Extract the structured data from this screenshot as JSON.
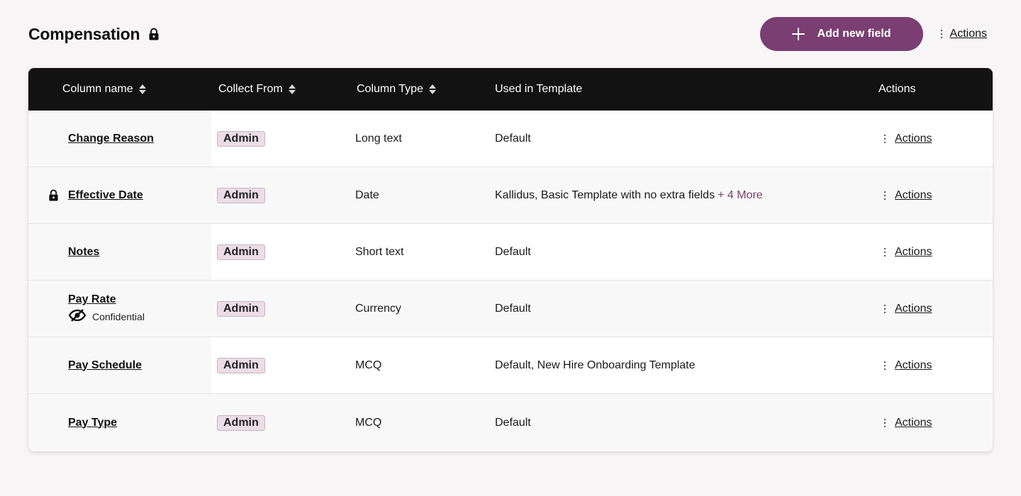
{
  "header": {
    "title": "Compensation",
    "add_button_label": "Add new field",
    "actions_label": "Actions"
  },
  "table": {
    "columns": [
      "Column name",
      "Collect From",
      "Column Type",
      "Used in Template",
      "Actions"
    ],
    "rows": [
      {
        "name": "Change Reason",
        "locked": false,
        "confidential": "",
        "collect_from": "Admin",
        "type": "Long text",
        "template": "Default",
        "more": "",
        "actions": "Actions"
      },
      {
        "name": "Effective Date",
        "locked": true,
        "confidential": "",
        "collect_from": "Admin",
        "type": "Date",
        "template": "Kallidus, Basic Template with no extra fields",
        "more": "+ 4 More",
        "actions": "Actions"
      },
      {
        "name": "Notes",
        "locked": false,
        "confidential": "",
        "collect_from": "Admin",
        "type": "Short text",
        "template": "Default",
        "more": "",
        "actions": "Actions"
      },
      {
        "name": "Pay Rate",
        "locked": false,
        "confidential": "Confidential",
        "collect_from": "Admin",
        "type": "Currency",
        "template": "Default",
        "more": "",
        "actions": "Actions"
      },
      {
        "name": "Pay Schedule",
        "locked": false,
        "confidential": "",
        "collect_from": "Admin",
        "type": "MCQ",
        "template": "Default, New Hire Onboarding Template",
        "more": "",
        "actions": "Actions"
      },
      {
        "name": "Pay Type",
        "locked": false,
        "confidential": "",
        "collect_from": "Admin",
        "type": "MCQ",
        "template": "Default",
        "more": "",
        "actions": "Actions"
      }
    ]
  },
  "colors": {
    "accent": "#7a3e72",
    "header_bg": "#121212",
    "badge_bg": "#ebdde6"
  },
  "icons": [
    "lock-icon",
    "plus-icon",
    "kebab-icon",
    "sort-icon",
    "eye-slash-icon"
  ]
}
